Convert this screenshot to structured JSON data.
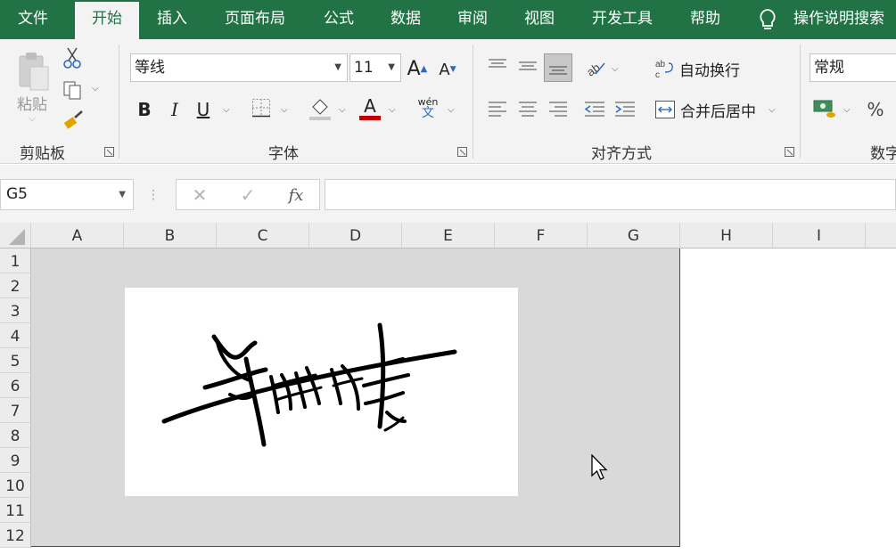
{
  "menu": {
    "tabs": [
      "文件",
      "开始",
      "插入",
      "页面布局",
      "公式",
      "数据",
      "审阅",
      "视图",
      "开发工具",
      "帮助"
    ],
    "active_tab": "开始",
    "search_label": "操作说明搜索"
  },
  "ribbon": {
    "clipboard": {
      "paste_label": "粘贴",
      "group_label": "剪贴板"
    },
    "font": {
      "font_name": "等线",
      "font_size": "11",
      "group_label": "字体",
      "phonetic_top": "wén",
      "phonetic_bottom": "文"
    },
    "alignment": {
      "wrap_text": "自动换行",
      "merge_center": "合并后居中",
      "group_label": "对齐方式"
    },
    "number": {
      "format": "常规",
      "percent": "%",
      "group_label": "数字"
    }
  },
  "formula_bar": {
    "name_box": "G5",
    "fx": "fx",
    "formula": ""
  },
  "grid": {
    "columns": [
      "A",
      "B",
      "C",
      "D",
      "E",
      "F",
      "G",
      "H",
      "I"
    ],
    "rows": [
      "1",
      "2",
      "3",
      "4",
      "5",
      "6",
      "7",
      "8",
      "9",
      "10",
      "11",
      "12"
    ]
  },
  "signature_image": {
    "icon": "handwritten-signature"
  },
  "colors": {
    "brand": "#217346",
    "ribbon_bg": "#f3f3f3",
    "sheet_gray": "#d9d9d9",
    "font_color_bar": "#c00000"
  }
}
